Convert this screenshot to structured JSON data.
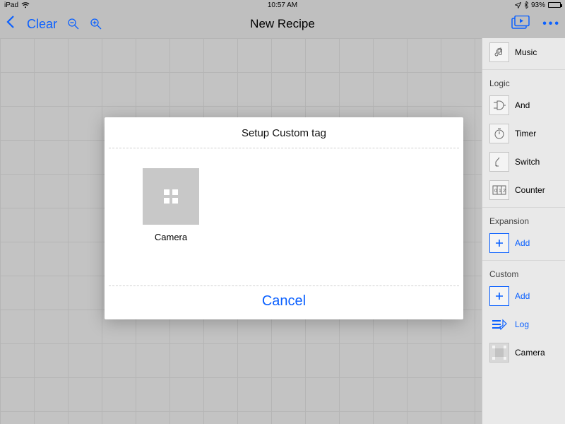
{
  "status": {
    "device": "iPad",
    "time": "10:57 AM",
    "battery_pct": "93%"
  },
  "nav": {
    "clear": "Clear",
    "title": "New Recipe"
  },
  "sidebar": {
    "music": "Music",
    "section_logic": "Logic",
    "and": "And",
    "timer": "Timer",
    "switch": "Switch",
    "counter": "Counter",
    "section_expansion": "Expansion",
    "add_expansion": "Add",
    "section_custom": "Custom",
    "add_custom": "Add",
    "log": "Log",
    "camera": "Camera"
  },
  "modal": {
    "title": "Setup Custom tag",
    "tile_camera": "Camera",
    "cancel": "Cancel"
  }
}
